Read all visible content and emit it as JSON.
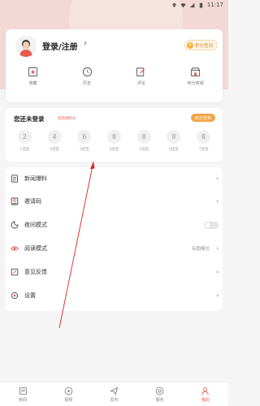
{
  "status_bar": {
    "time": "11:17"
  },
  "profile": {
    "login_label": "登录/注册",
    "points_badge": "积分签到",
    "quick_links": [
      {
        "label": "收藏",
        "icon": "star-box-icon"
      },
      {
        "label": "历史",
        "icon": "clock-icon"
      },
      {
        "label": "评论",
        "icon": "edit-icon"
      },
      {
        "label": "积分商城",
        "icon": "shop-icon"
      }
    ]
  },
  "sign_in": {
    "title": "您还未登录",
    "hint": "签到领积分",
    "button": "积分签到",
    "days": [
      {
        "points": "2",
        "label": "1连签"
      },
      {
        "points": "4",
        "label": "2连签"
      },
      {
        "points": "6",
        "label": "3连签"
      },
      {
        "points": "8",
        "label": "4连签"
      },
      {
        "points": "8",
        "label": "5连签"
      },
      {
        "points": "8",
        "label": "6连签"
      },
      {
        "points": "8",
        "label": "7连签"
      }
    ]
  },
  "menu": [
    {
      "label": "新闻爆料",
      "icon": "document-icon"
    },
    {
      "label": "邀请码",
      "icon": "invite-icon"
    },
    {
      "label": "夜间模式",
      "icon": "night-icon",
      "toggle": "off"
    },
    {
      "label": "阅读模式",
      "icon": "eye-icon",
      "value": "有图模式"
    },
    {
      "label": "意见反馈",
      "icon": "feedback-icon"
    },
    {
      "label": "设置",
      "icon": "settings-icon"
    }
  ],
  "tabs": [
    {
      "label": "新闻",
      "icon": "news-icon"
    },
    {
      "label": "视频",
      "icon": "video-icon"
    },
    {
      "label": "发布",
      "icon": "publish-icon"
    },
    {
      "label": "服务",
      "icon": "service-icon"
    },
    {
      "label": "我的",
      "icon": "profile-icon",
      "active": true
    }
  ],
  "colors": {
    "accent": "#e85a4f",
    "hero_bg": "#f3d8d5",
    "points_orange": "#f3a33f"
  }
}
